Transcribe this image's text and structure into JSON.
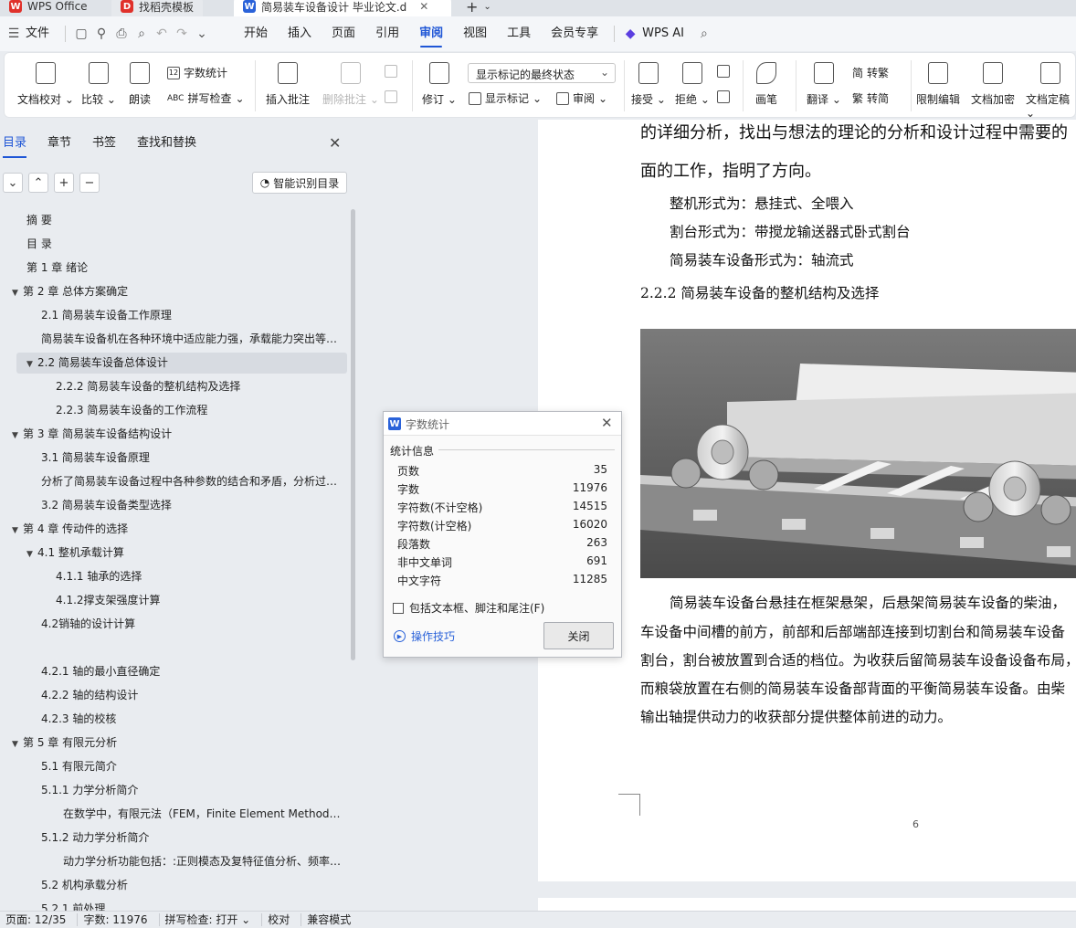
{
  "tabs": [
    {
      "label": "WPS Office"
    },
    {
      "label": "找稻壳模板"
    },
    {
      "label": "简易装车设备设计 毕业论文.d"
    }
  ],
  "menu": {
    "file": "文件",
    "items": [
      "开始",
      "插入",
      "页面",
      "引用",
      "审阅",
      "视图",
      "工具",
      "会员专享"
    ],
    "active": "审阅",
    "ai": "WPS AI"
  },
  "ribbon": {
    "proofread": "文档校对",
    "compare": "比较",
    "read_aloud": "朗读",
    "word_count": "字数统计",
    "spell_check": "拼写检查",
    "insert_comment": "插入批注",
    "delete_comment": "删除批注",
    "track": "修订",
    "markup_select": "显示标记的最终状态",
    "show_markup": "显示标记",
    "review": "审阅",
    "accept": "接受",
    "reject": "拒绝",
    "pen": "画笔",
    "translate": "翻译",
    "to_traditional": "转繁",
    "to_simplified": "转简",
    "restrict_edit": "限制编辑",
    "encrypt": "文档加密",
    "finalize": "文档定稿"
  },
  "nav": {
    "tabs": [
      "目录",
      "章节",
      "书签",
      "查找和替换"
    ],
    "smart_button": "智能识别目录",
    "toc": [
      "摘  要",
      "目  录",
      "第 1 章  绪论",
      "第 2 章  总体方案确定",
      "2.1   简易装车设备工作原理",
      "简易装车设备机在各种环境中适应能力强，承载能力突出等优点",
      "2.2 简易装车设备总体设计",
      "2.2.2  简易装车设备的整机结构及选择",
      "2.2.3  简易装车设备的工作流程",
      "第 3 章  简易装车设备结构设计",
      "3.1   简易装车设备原理",
      "分析了简易装车设备过程中各种参数的结合和矛盾，分析过程中需要",
      "3.2   简易装车设备类型选择",
      "第 4 章  传动件的选择",
      "4.1   整机承载计算",
      "4.1.1    轴承的选择",
      "4.1.2撑支架强度计算",
      "4.2销轴的设计计算",
      "4.2.1    轴的最小直径确定",
      "4.2.2    轴的结构设计",
      "4.2.3    轴的校核",
      "第 5 章  有限元分析",
      "5.1    有限元简介",
      "5.1.1    力学分析简介",
      "在数学中，有限元法（FEM，Finite Element Method）是一种",
      "5.1.2    动力学分析简介",
      "动力学分析功能包括：:正则模态及复特征值分析、频率响应分析",
      "5.2   机构承载分析",
      "5.2.1    前处理"
    ]
  },
  "doc": {
    "line1": "的详细分析，找出与想法的理论的分析和设计过程中需要的",
    "line2": "面的工作，指明了方向。",
    "line3": "整机形式为：悬挂式、全喂入",
    "line4": "割台形式为：带搅龙输送器式卧式割台",
    "line5": "简易装车设备形式为：轴流式",
    "heading": "2.2.2  简易装车设备的整机结构及选择",
    "para": [
      "简易装车设备台悬挂在框架悬架，后悬架简易装车设备的柴油，",
      "车设备中间槽的前方，前部和后部端部连接到切割台和简易装车设备",
      "割台，割台被放置到合适的档位。为收获后留简易装车设备设备布局，",
      "而粮袋放置在右侧的简易装车设备部背面的平衡简易装车设备。由柴",
      "输出轴提供动力的收获部分提供整体前进的动力。"
    ],
    "page_number": "6"
  },
  "dialog": {
    "title": "字数统计",
    "section": "统计信息",
    "stats": [
      {
        "label": "页数",
        "value": "35"
      },
      {
        "label": "字数",
        "value": "11976"
      },
      {
        "label": "字符数(不计空格)",
        "value": "14515"
      },
      {
        "label": "字符数(计空格)",
        "value": "16020"
      },
      {
        "label": "段落数",
        "value": "263"
      },
      {
        "label": "非中文单词",
        "value": "691"
      },
      {
        "label": "中文字符",
        "value": "11285"
      }
    ],
    "checkbox": "包括文本框、脚注和尾注(F)",
    "tips": "操作技巧",
    "close": "关闭"
  },
  "status": {
    "page": "页面: 12/35",
    "words": "字数: 11976",
    "spell": "拼写检查: 打开",
    "proof": "校对",
    "compat": "兼容模式"
  }
}
